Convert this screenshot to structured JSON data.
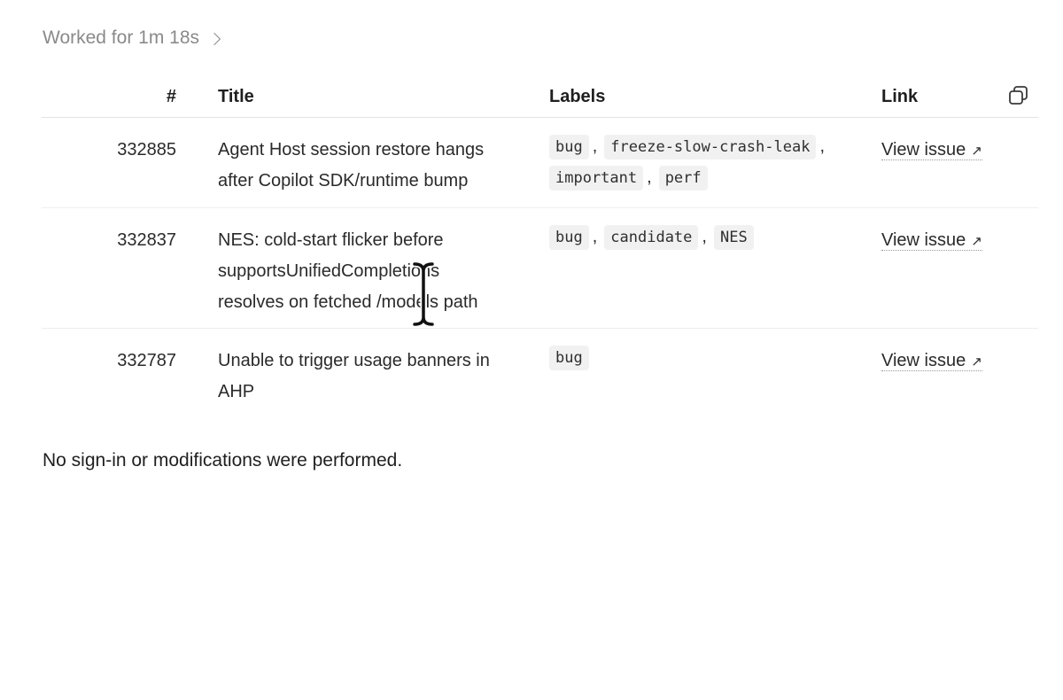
{
  "summary": {
    "worked_label": "Worked for 1m 18s"
  },
  "table": {
    "headers": {
      "num": "#",
      "title": "Title",
      "labels": "Labels",
      "link": "Link"
    },
    "rows": [
      {
        "num": "332885",
        "title": "Agent Host session restore hangs after Copilot SDK/runtime bump",
        "labels": [
          "bug",
          "freeze-slow-crash-leak",
          "important",
          "perf"
        ],
        "link": "View issue"
      },
      {
        "num": "332837",
        "title": "NES: cold-start flicker before supportsUnifiedCompletions resolves on fetched /models path",
        "labels": [
          "bug",
          "candidate",
          "NES"
        ],
        "link": "View issue"
      },
      {
        "num": "332787",
        "title": "Unable to trigger usage banners in AHP",
        "labels": [
          "bug"
        ],
        "link": "View issue"
      }
    ]
  },
  "footer": {
    "text": "No sign-in or modifications were performed."
  },
  "icons": {
    "expand": "chevron-right-icon",
    "copy": "copy-icon",
    "external": "external-link-arrow-icon",
    "cursor": "text-cursor-icon"
  },
  "colors": {
    "muted_text": "#8a8a8a",
    "label_background": "#f1f1f1",
    "divider": "#e4e4e4"
  }
}
